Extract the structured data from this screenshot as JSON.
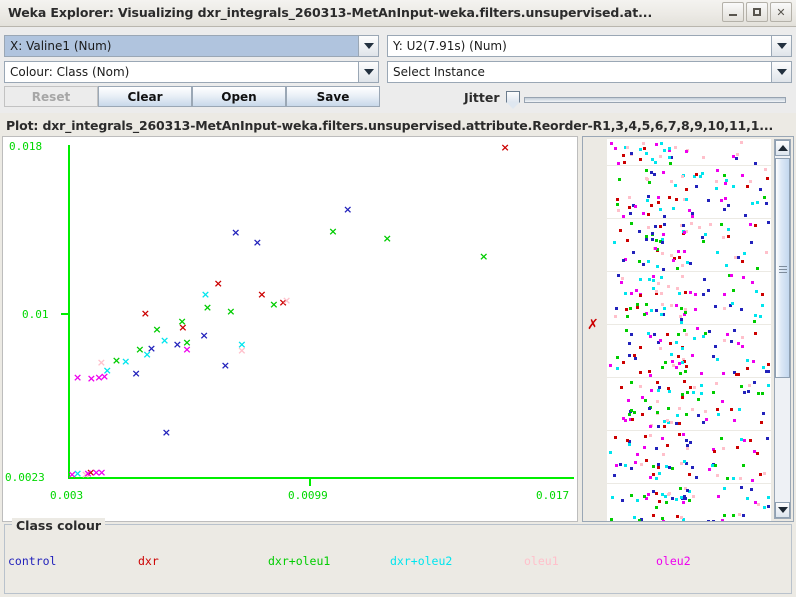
{
  "window": {
    "title": "Weka Explorer: Visualizing dxr_integrals_260313-MetAnInput-weka.filters.unsupervised.at...",
    "minimize_label": "–",
    "maximize_label": "□",
    "close_label": "✕"
  },
  "controls": {
    "x_axis_combo": "X: Valine1 (Num)",
    "y_axis_combo": "Y: U2(7.91s) (Num)",
    "colour_combo": "Colour: Class (Nom)",
    "instance_combo": "Select Instance",
    "reset_label": "Reset",
    "clear_label": "Clear",
    "open_label": "Open",
    "save_label": "Save",
    "jitter_label": "Jitter",
    "jitter_value": 0
  },
  "plot": {
    "title": "Plot: dxr_integrals_260313-MetAnInput-weka.filters.unsupervised.attribute.Reorder-R1,3,4,5,6,7,8,9,10,11,1...",
    "y_top_label": "0.018",
    "y_mid_label": "0.01",
    "y_bottom_label": "0.0023",
    "x_left_label": "0.003",
    "x_mid_label": "0.0099",
    "x_right_label": "0.017",
    "axis_colour": "#00ee00",
    "marker_glyph": "×"
  },
  "chart_data": {
    "type": "scatter",
    "title": "Plot: dxr_integrals_260313-MetAnInput-weka.filters.unsupervised.attribute.Reorder-R1,3,4,5,6,7,8,9,10,11,1...",
    "xlabel": "Valine1 (Num)",
    "ylabel": "U2(7.91s) (Num)",
    "xlim": [
      0.003,
      0.017
    ],
    "ylim": [
      0.0023,
      0.018
    ],
    "xticks": [
      0.003,
      0.0099,
      0.017
    ],
    "yticks": [
      0.0023,
      0.01,
      0.018
    ],
    "grid": false,
    "legend_position": "bottom",
    "marker": "x",
    "series": [
      {
        "name": "control",
        "color": "#2222bb",
        "points": [
          [
            0.00782,
            0.01392
          ],
          [
            0.00845,
            0.01346
          ],
          [
            0.01108,
            0.01503
          ],
          [
            0.0069,
            0.00905
          ],
          [
            0.00612,
            0.00861
          ],
          [
            0.00537,
            0.00842
          ],
          [
            0.00752,
            0.00762
          ],
          [
            0.0058,
            0.0044
          ],
          [
            0.00492,
            0.00721
          ]
        ]
      },
      {
        "name": "dxr",
        "color": "#cc0000",
        "points": [
          [
            0.01566,
            0.018
          ],
          [
            0.00731,
            0.0115
          ],
          [
            0.00858,
            0.011
          ],
          [
            0.0092,
            0.01062
          ],
          [
            0.00519,
            0.0101
          ],
          [
            0.00628,
            0.00943
          ],
          [
            0.0036,
            0.0025
          ]
        ]
      },
      {
        "name": "dxr+oleu1",
        "color": "#00cc00",
        "points": [
          [
            0.01065,
            0.01397
          ],
          [
            0.01223,
            0.01366
          ],
          [
            0.01504,
            0.0128
          ],
          [
            0.00893,
            0.0105
          ],
          [
            0.007,
            0.01038
          ],
          [
            0.00768,
            0.01018
          ],
          [
            0.00626,
            0.00972
          ],
          [
            0.00553,
            0.0093
          ],
          [
            0.0064,
            0.00872
          ],
          [
            0.00503,
            0.00835
          ],
          [
            0.00435,
            0.00782
          ]
        ]
      },
      {
        "name": "dxr+oleu2",
        "color": "#00e5ee",
        "points": [
          [
            0.00694,
            0.011
          ],
          [
            0.00575,
            0.0088
          ],
          [
            0.008,
            0.00862
          ],
          [
            0.00524,
            0.00812
          ],
          [
            0.00462,
            0.0078
          ],
          [
            0.00408,
            0.00735
          ],
          [
            0.00322,
            0.00245
          ]
        ]
      },
      {
        "name": "oleu1",
        "color": "#ffc0cb",
        "points": [
          [
            0.0093,
            0.01068
          ],
          [
            0.008,
            0.0083
          ],
          [
            0.00391,
            0.00775
          ],
          [
            0.00345,
            0.00243
          ]
        ]
      },
      {
        "name": "oleu2",
        "color": "#ee00ee",
        "points": [
          [
            0.0064,
            0.00835
          ],
          [
            0.00322,
            0.00705
          ],
          [
            0.00362,
            0.007
          ],
          [
            0.00384,
            0.00702
          ],
          [
            0.004,
            0.00706
          ],
          [
            0.00306,
            0.0024
          ],
          [
            0.00352,
            0.00248
          ],
          [
            0.00376,
            0.0025
          ],
          [
            0.00392,
            0.00252
          ]
        ]
      }
    ]
  },
  "legend": {
    "title": "Class colour",
    "items": [
      {
        "label": "control",
        "color": "#2222bb"
      },
      {
        "label": "dxr",
        "color": "#cc0000"
      },
      {
        "label": "dxr+oleu1",
        "color": "#00cc00"
      },
      {
        "label": "dxr+oleu2",
        "color": "#00e5ee"
      },
      {
        "label": "oleu1",
        "color": "#ffc0cb"
      },
      {
        "label": "oleu2",
        "color": "#ee00ee"
      }
    ]
  },
  "strip_panel": {
    "marker_glyph": "✗",
    "band_count": 15,
    "dot_colors": [
      "#ee00ee",
      "#00e5ee",
      "#00cc00",
      "#cc0000",
      "#2222bb",
      "#ffc0cb"
    ]
  }
}
